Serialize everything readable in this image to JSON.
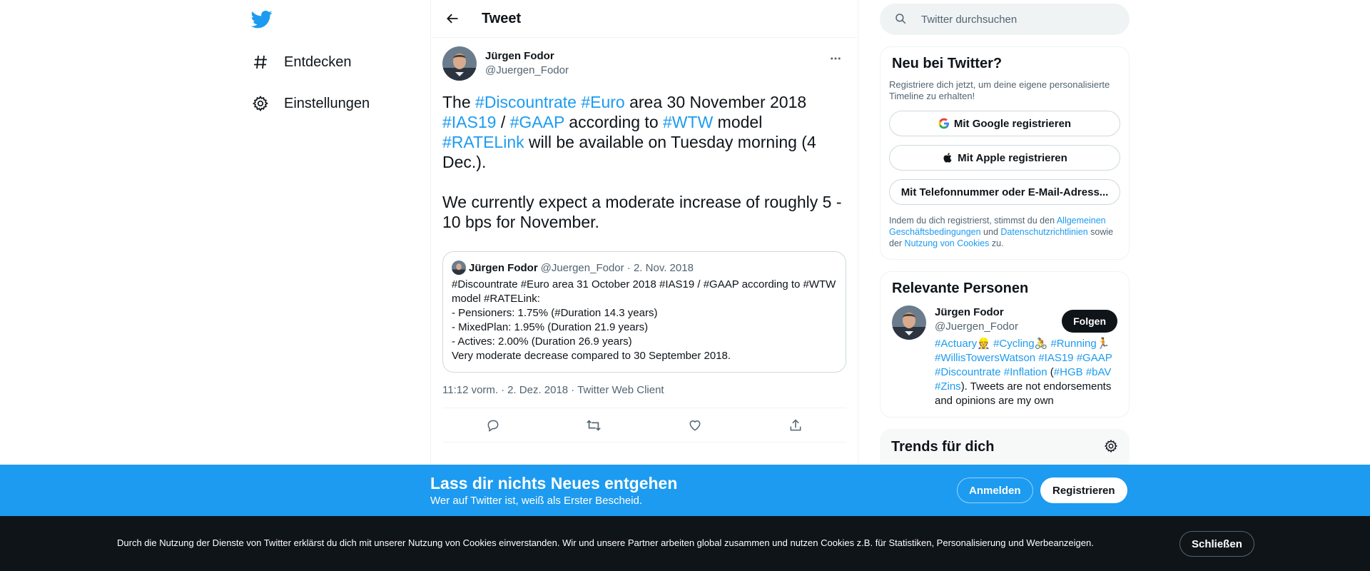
{
  "nav": {
    "items": [
      {
        "label": "Entdecken"
      },
      {
        "label": "Einstellungen"
      }
    ]
  },
  "header": {
    "title": "Tweet"
  },
  "tweet": {
    "author_name": "Jürgen Fodor",
    "author_handle": "@Juergen_Fodor",
    "para1_parts": [
      "The ",
      "#Discountrate",
      " ",
      "#Euro",
      " area 30 November 2018 ",
      "#IAS19",
      " / ",
      "#GAAP",
      " according to ",
      "#WTW",
      " model ",
      "#RATELink",
      " will be available on Tuesday morning (4 Dec.)."
    ],
    "para2": "We currently expect a moderate increase of roughly 5 - 10 bps for November.",
    "timestamp": "11:12 vorm.",
    "date": "2. Dez. 2018",
    "client": "Twitter Web Client",
    "sep": "·"
  },
  "quote": {
    "author_name": "Jürgen Fodor",
    "meta": "@Juergen_Fodor · 2. Nov. 2018",
    "lines": [
      "#Discountrate #Euro area 31 October 2018 #IAS19 / #GAAP according to #WTW model #RATELink:",
      "- Pensioners: 1.75% (#Duration 14.3 years)",
      "- MixedPlan: 1.95% (Duration 21.9 years)",
      "- Actives: 2.00%  (Duration 26.9 years)",
      "Very moderate decrease compared to 30 September 2018."
    ]
  },
  "search": {
    "placeholder": "Twitter durchsuchen"
  },
  "signup": {
    "title": "Neu bei Twitter?",
    "desc": "Registriere dich jetzt, um deine eigene personalisierte Timeline zu erhalten!",
    "google": "Mit Google registrieren",
    "apple": "Mit Apple registrieren",
    "phone": "Mit Telefonnummer oder E-Mail-Adress...",
    "legal_1": "Indem du dich registrierst, stimmst du den ",
    "legal_link1": "Allgemeinen Geschäftsbedingungen",
    "legal_2": " und ",
    "legal_link2": "Datenschutzrichtlinien",
    "legal_3": " sowie der ",
    "legal_link3": "Nutzung von Cookies",
    "legal_4": " zu."
  },
  "people": {
    "title": "Relevante Personen",
    "name": "Jürgen Fodor",
    "handle": "@Juergen_Fodor",
    "follow": "Folgen",
    "bio_parts": [
      {
        "t": "#Actuary",
        "link": true
      },
      {
        "t": "👷 ",
        "link": true
      },
      {
        "t": "#Cycling",
        "link": true
      },
      {
        "t": "🚴 ",
        "link": true
      },
      {
        "t": "#Running",
        "link": true
      },
      {
        "t": "🏃 ",
        "link": true
      },
      {
        "t": "#WillisTowersWatson",
        "link": true
      },
      {
        "t": " ",
        "link": false
      },
      {
        "t": "#IAS19",
        "link": true
      },
      {
        "t": " ",
        "link": false
      },
      {
        "t": "#GAAP",
        "link": true
      },
      {
        "t": " ",
        "link": false
      },
      {
        "t": "#Discountrate",
        "link": true
      },
      {
        "t": " ",
        "link": false
      },
      {
        "t": "#Inflation",
        "link": true
      },
      {
        "t": " (",
        "link": false
      },
      {
        "t": "#HGB",
        "link": true
      },
      {
        "t": " ",
        "link": false
      },
      {
        "t": "#bAV",
        "link": true
      },
      {
        "t": " ",
        "link": false
      },
      {
        "t": "#Zins",
        "link": true
      },
      {
        "t": "). Tweets are not endorsements and opinions are my own",
        "link": false
      }
    ]
  },
  "trends": {
    "title": "Trends für dich"
  },
  "bottombar": {
    "title": "Lass dir nichts Neues entgehen",
    "subtitle": "Wer auf Twitter ist, weiß als Erster Bescheid.",
    "login": "Anmelden",
    "register": "Registrieren"
  },
  "cookie": {
    "text": "Durch die Nutzung der Dienste von Twitter erklärst du dich mit unserer Nutzung von Cookies einverstanden. Wir und unsere Partner arbeiten global zusammen und nutzen Cookies z.B. für Statistiken, Personalisierung und Werbeanzeigen.",
    "close": "Schließen"
  },
  "colors": {
    "accent": "#1d9bf0",
    "text": "#0f1419",
    "muted": "#536471",
    "border": "#eff3f4"
  },
  "icons": [
    "twitter-logo-icon",
    "hashtag-icon",
    "gear-icon",
    "back-arrow-icon",
    "more-icon",
    "reply-icon",
    "retweet-icon",
    "like-icon",
    "share-icon",
    "search-icon",
    "google-icon",
    "apple-icon"
  ]
}
